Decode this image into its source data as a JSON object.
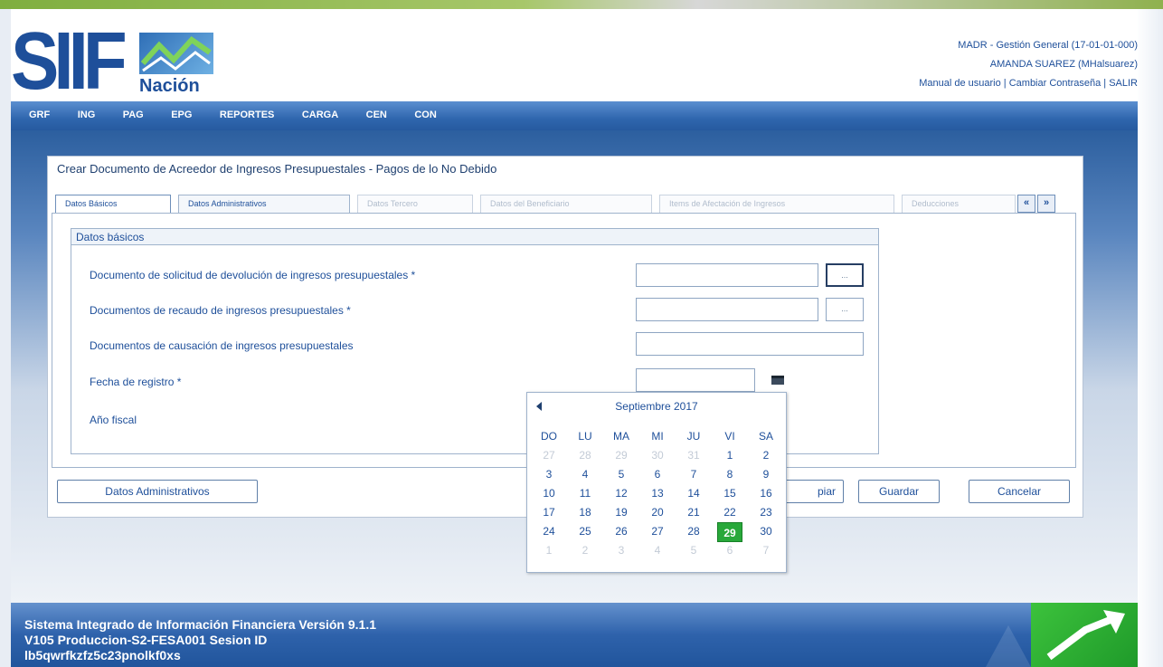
{
  "header": {
    "logo_main": "SIIF",
    "logo_sub": "Nación",
    "entity": "MADR - Gestión General (17-01-01-000)",
    "user": "AMANDA SUAREZ (MHalsuarez)",
    "manual_link": "Manual de usuario",
    "change_password_link": "Cambiar Contraseña",
    "exit_link": "SALIR",
    "separator": "|"
  },
  "menu": [
    "GRF",
    "ING",
    "PAG",
    "EPG",
    "REPORTES",
    "CARGA",
    "CEN",
    "CON"
  ],
  "panel": {
    "title": "Crear Documento de Acreedor de Ingresos Presupuestales - Pagos de lo No Debido"
  },
  "tabs": [
    {
      "label": "Datos Básicos"
    },
    {
      "label": "Datos Administrativos"
    },
    {
      "label": "Datos Tercero"
    },
    {
      "label": "Datos del Beneficiario"
    },
    {
      "label": "Items de Afectación de Ingresos"
    },
    {
      "label": "Deducciones"
    }
  ],
  "tab_nav": {
    "prev": "«",
    "next": "»"
  },
  "form": {
    "legend": "Datos básicos",
    "solicitud_label": "Documento de solicitud de devolución de ingresos presupuestales *",
    "recaudo_label": "Documentos de recaudo de ingresos presupuestales *",
    "causacion_label": "Documentos de causación de ingresos presupuestales",
    "fecha_label": "Fecha de registro *",
    "anio_label": "Año fiscal",
    "lookup_btn": "..."
  },
  "buttons": {
    "datos_admin": "Datos Administrativos",
    "limpiar": "piar",
    "guardar": "Guardar",
    "cancelar": "Cancelar"
  },
  "calendar": {
    "title": "Septiembre 2017",
    "weekdays": [
      "DO",
      "LU",
      "MA",
      "MI",
      "JU",
      "VI",
      "SA"
    ],
    "weeks": [
      [
        "27",
        "28",
        "29",
        "30",
        "31",
        "1",
        "2"
      ],
      [
        "3",
        "4",
        "5",
        "6",
        "7",
        "8",
        "9"
      ],
      [
        "10",
        "11",
        "12",
        "13",
        "14",
        "15",
        "16"
      ],
      [
        "17",
        "18",
        "19",
        "20",
        "21",
        "22",
        "23"
      ],
      [
        "24",
        "25",
        "26",
        "27",
        "28",
        "29",
        "30"
      ],
      [
        "1",
        "2",
        "3",
        "4",
        "5",
        "6",
        "7"
      ]
    ],
    "selected_day": "29",
    "highlight_color": "#28a83a"
  },
  "footer": {
    "line1": "Sistema Integrado de Información Financiera Versión 9.1.1",
    "line2": "V105 Produccion-S2-FESA001 Sesion ID",
    "line3": "lb5qwrfkzfz5c23pnolkf0xs"
  }
}
